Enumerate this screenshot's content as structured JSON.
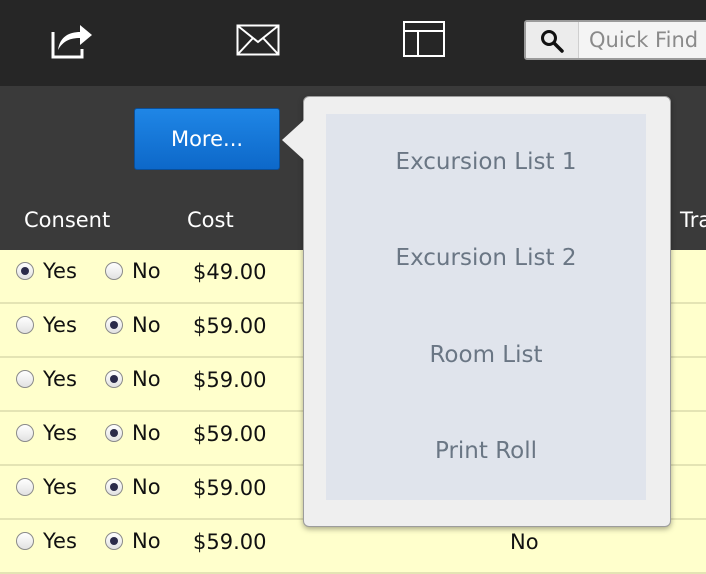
{
  "search": {
    "placeholder": "Quick Find"
  },
  "toolbar": {
    "icons": [
      "share-icon",
      "mail-icon",
      "layout-icon",
      "search-icon"
    ],
    "more_label": "More..."
  },
  "table": {
    "headers": [
      "Consent",
      "Cost",
      "Tra"
    ],
    "rows": [
      {
        "consent": "yes",
        "yes_label": "Yes",
        "no_label": "No",
        "cost": "$49.00",
        "tail": ""
      },
      {
        "consent": "no",
        "yes_label": "Yes",
        "no_label": "No",
        "cost": "$59.00",
        "tail": ""
      },
      {
        "consent": "no",
        "yes_label": "Yes",
        "no_label": "No",
        "cost": "$59.00",
        "tail": ""
      },
      {
        "consent": "no",
        "yes_label": "Yes",
        "no_label": "No",
        "cost": "$59.00",
        "tail": ""
      },
      {
        "consent": "no",
        "yes_label": "Yes",
        "no_label": "No",
        "cost": "$59.00",
        "tail": ""
      },
      {
        "consent": "no",
        "yes_label": "Yes",
        "no_label": "No",
        "cost": "$59.00",
        "tail": "No"
      }
    ]
  },
  "menu": {
    "items": [
      "Excursion List 1",
      "Excursion List 2",
      "Room List",
      "Print Roll"
    ]
  },
  "colors": {
    "topbar": "#262626",
    "button": "#0d68c9",
    "row": "#ffffcc",
    "menu_bg": "#e0e4ec",
    "menu_text": "#6a7684"
  }
}
